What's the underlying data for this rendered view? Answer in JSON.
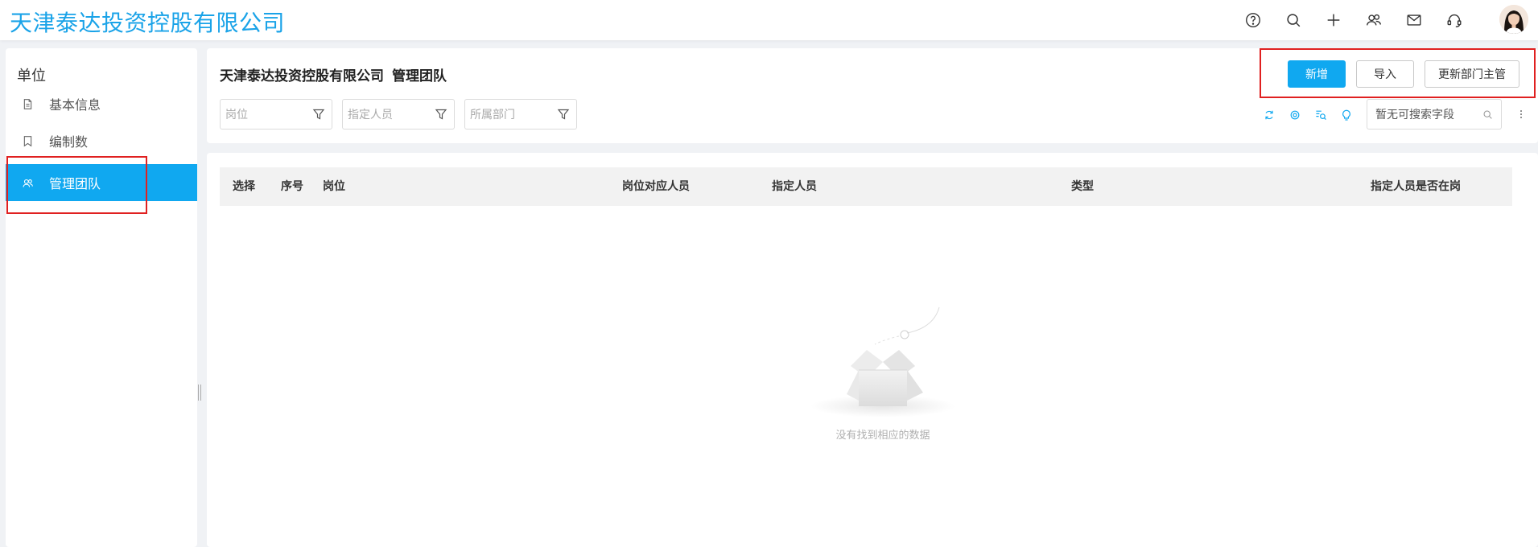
{
  "header": {
    "brand": "天津泰达投资控股有限公司",
    "icons": [
      "help-icon",
      "search-icon",
      "plus-icon",
      "contacts-icon",
      "mail-icon",
      "headset-icon"
    ]
  },
  "sidebar": {
    "title": "单位",
    "items": [
      {
        "label": "基本信息",
        "icon": "document-icon",
        "active": false
      },
      {
        "label": "编制数",
        "icon": "bookmark-icon",
        "active": false
      },
      {
        "label": "管理团队",
        "icon": "team-icon",
        "active": true
      }
    ]
  },
  "panel": {
    "title": "天津泰达投资控股有限公司",
    "subtitle": "管理团队",
    "filters": [
      {
        "placeholder": "岗位"
      },
      {
        "placeholder": "指定人员"
      },
      {
        "placeholder": "所属部门"
      }
    ],
    "buttons": {
      "add": "新增",
      "import": "导入",
      "update_manager": "更新部门主管"
    },
    "search_placeholder": "暂无可搜索字段"
  },
  "table": {
    "columns": [
      "选择",
      "序号",
      "岗位",
      "岗位对应人员",
      "指定人员",
      "类型",
      "指定人员是否在岗"
    ],
    "rows": [],
    "empty_text": "没有找到相应的数据"
  },
  "colors": {
    "accent": "#10a8f0",
    "brand": "#1aa3e8",
    "highlight": "#e02020"
  }
}
